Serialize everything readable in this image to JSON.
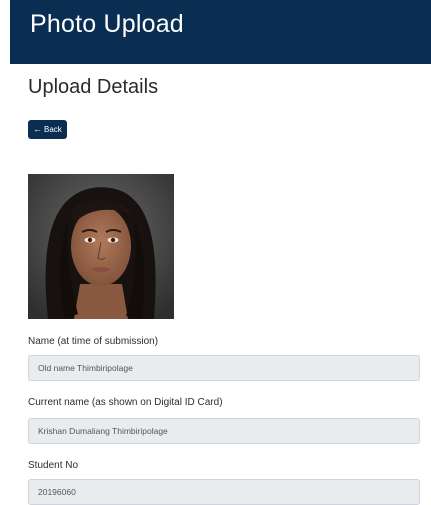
{
  "header": {
    "title": "Photo Upload"
  },
  "section": {
    "title": "Upload Details"
  },
  "back_button": {
    "label": "Back",
    "icon": "arrow-left-icon"
  },
  "fields": {
    "name_at_submission": {
      "label": "Name (at time of submission)",
      "value": "Old name Thimbiripolage"
    },
    "current_name": {
      "label": "Current name (as shown on Digital ID Card)",
      "value": "Krishan Dumaliang Thimbiripolage"
    },
    "student_no": {
      "label": "Student No",
      "value": "20196060"
    }
  },
  "colors": {
    "brand": "#0a2e52",
    "input_bg": "#e9ecef"
  }
}
